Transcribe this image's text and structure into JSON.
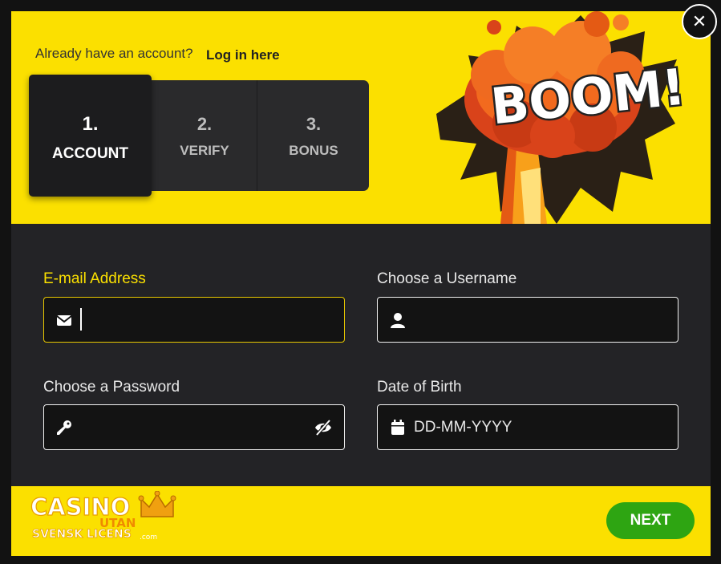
{
  "header": {
    "already_text": "Already have an account?",
    "login_link": "Log in here"
  },
  "steps": [
    {
      "num": "1.",
      "label": "ACCOUNT",
      "active": true
    },
    {
      "num": "2.",
      "label": "VERIFY",
      "active": false
    },
    {
      "num": "3.",
      "label": "BONUS",
      "active": false
    }
  ],
  "banner": {
    "text": "BOOM!"
  },
  "close": {
    "icon": "close-icon",
    "symbol": "✕"
  },
  "form": {
    "email": {
      "label": "E-mail Address",
      "value": "",
      "placeholder": "",
      "icon": "envelope-icon",
      "focused": true
    },
    "username": {
      "label": "Choose a Username",
      "value": "",
      "placeholder": "",
      "icon": "user-icon"
    },
    "password": {
      "label": "Choose a Password",
      "value": "",
      "placeholder": "",
      "icon": "key-icon",
      "toggle_icon": "eye-slash-icon"
    },
    "dob": {
      "label": "Date of Birth",
      "value": "",
      "placeholder": "DD-MM-YYYY",
      "icon": "calendar-icon"
    }
  },
  "footer": {
    "logo": {
      "word1": "CASINO",
      "word2": "UTAN",
      "word3": "SVENSK LICENS",
      "tld": ".com"
    },
    "next_label": "NEXT"
  },
  "colors": {
    "accent": "#fbe000",
    "panel": "#232326",
    "button": "#2ea512"
  }
}
